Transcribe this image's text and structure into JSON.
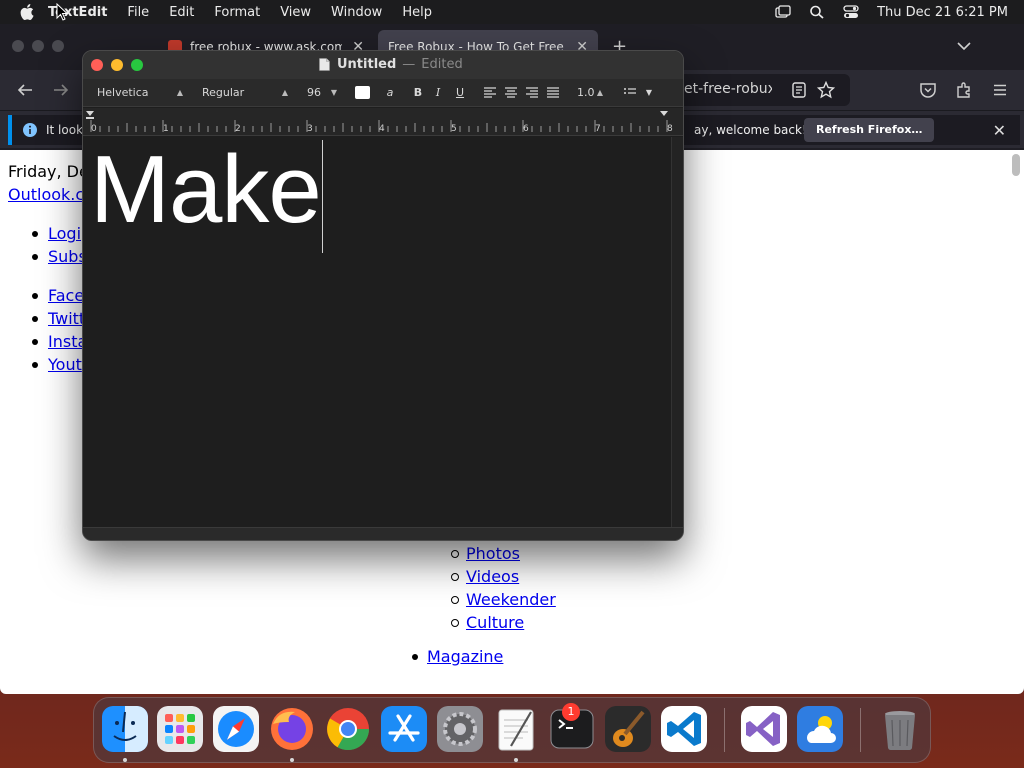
{
  "menubar": {
    "app_name": "TextEdit",
    "items": [
      "File",
      "Edit",
      "Format",
      "View",
      "Window",
      "Help"
    ],
    "clock": "Thu Dec 21  6:21 PM",
    "icons": [
      "apple-icon",
      "screen-mirroring-icon",
      "spotlight-search-icon",
      "control-center-icon"
    ]
  },
  "firefox": {
    "tabs": [
      {
        "title": "free robux - www.ask.com",
        "active": false
      },
      {
        "title": "Free Robux - How To Get Free Robux",
        "active": true
      }
    ],
    "url_fragment": "et-free-robux-in",
    "notice": {
      "left_text": "It looks",
      "right_text": "ay, welcome back!",
      "button": "Refresh Firefox…"
    },
    "page": {
      "date": "Friday, Dec",
      "outlook": "Outlook.c",
      "list1": [
        "Logi",
        "Subs"
      ],
      "list2": [
        "Face",
        "Twitt",
        "Insta",
        "Yout"
      ],
      "sublist": [
        "Photos",
        "Videos",
        "Weekender",
        "Culture"
      ],
      "magazine": "Magazine"
    }
  },
  "textedit": {
    "title": "Untitled",
    "separator": "—",
    "status": "Edited",
    "font_family": "Helvetica",
    "font_style": "Regular",
    "font_size": "96",
    "line_spacing": "1.0",
    "ruler_numbers": [
      "0",
      "1",
      "2",
      "3",
      "4",
      "5",
      "6",
      "7",
      "8"
    ],
    "text": "Make",
    "text_color": "#ffffff"
  },
  "dock": {
    "apps": [
      "Finder",
      "Launchpad",
      "Safari",
      "Firefox",
      "Chrome",
      "App Store",
      "System Settings",
      "TextEdit",
      "Terminal",
      "GarageBand",
      "VS Code",
      "Visual Studio",
      "Weather",
      "Trash"
    ],
    "settings_badge": "1"
  }
}
